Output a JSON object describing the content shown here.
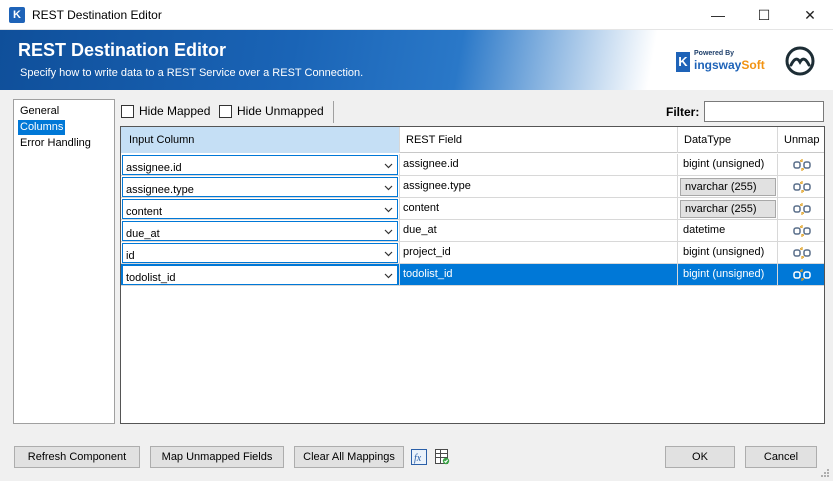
{
  "window": {
    "title": "REST Destination Editor",
    "app_icon_letter": "K",
    "minimize_glyph": "—",
    "maximize_glyph": "☐",
    "close_glyph": "✕"
  },
  "banner": {
    "title": "REST Destination Editor",
    "subtitle": "Specify how to write data to a REST Service over a REST Connection.",
    "logo_powered_by": "Powered By",
    "logo_brand_k": "K",
    "logo_brand_rest": "ingsway",
    "logo_brand_soft": "Soft"
  },
  "nav": {
    "items": [
      {
        "label": "General"
      },
      {
        "label": "Columns"
      },
      {
        "label": "Error Handling"
      }
    ]
  },
  "toolbar": {
    "hide_mapped_label": "Hide Mapped",
    "hide_unmapped_label": "Hide Unmapped",
    "filter_label": "Filter:",
    "filter_value": ""
  },
  "grid": {
    "headers": {
      "input_column": "Input Column",
      "rest_field": "REST Field",
      "data_type": "DataType",
      "unmap": "Unmap"
    },
    "rows": [
      {
        "input": "assignee.id",
        "rest_field": "assignee.id",
        "data_type": "bigint (unsigned)",
        "boxed": false
      },
      {
        "input": "assignee.type",
        "rest_field": "assignee.type",
        "data_type": "nvarchar (255)",
        "boxed": true
      },
      {
        "input": "content",
        "rest_field": "content",
        "data_type": "nvarchar (255)",
        "boxed": true
      },
      {
        "input": "due_at",
        "rest_field": "due_at",
        "data_type": "datetime",
        "boxed": false
      },
      {
        "input": "id",
        "rest_field": "project_id",
        "data_type": "bigint (unsigned)",
        "boxed": false
      },
      {
        "input": "todolist_id",
        "rest_field": "todolist_id",
        "data_type": "bigint (unsigned)",
        "boxed": false
      }
    ],
    "selected_row": 5
  },
  "footer": {
    "refresh_label": "Refresh Component",
    "map_unmapped_label": "Map Unmapped Fields",
    "clear_label": "Clear All Mappings",
    "fx_label": "fx",
    "ok_label": "OK",
    "cancel_label": "Cancel"
  },
  "colors": {
    "accent": "#0078d7",
    "banner_blue": "#1a64b6",
    "kw_orange": "#f29312"
  }
}
